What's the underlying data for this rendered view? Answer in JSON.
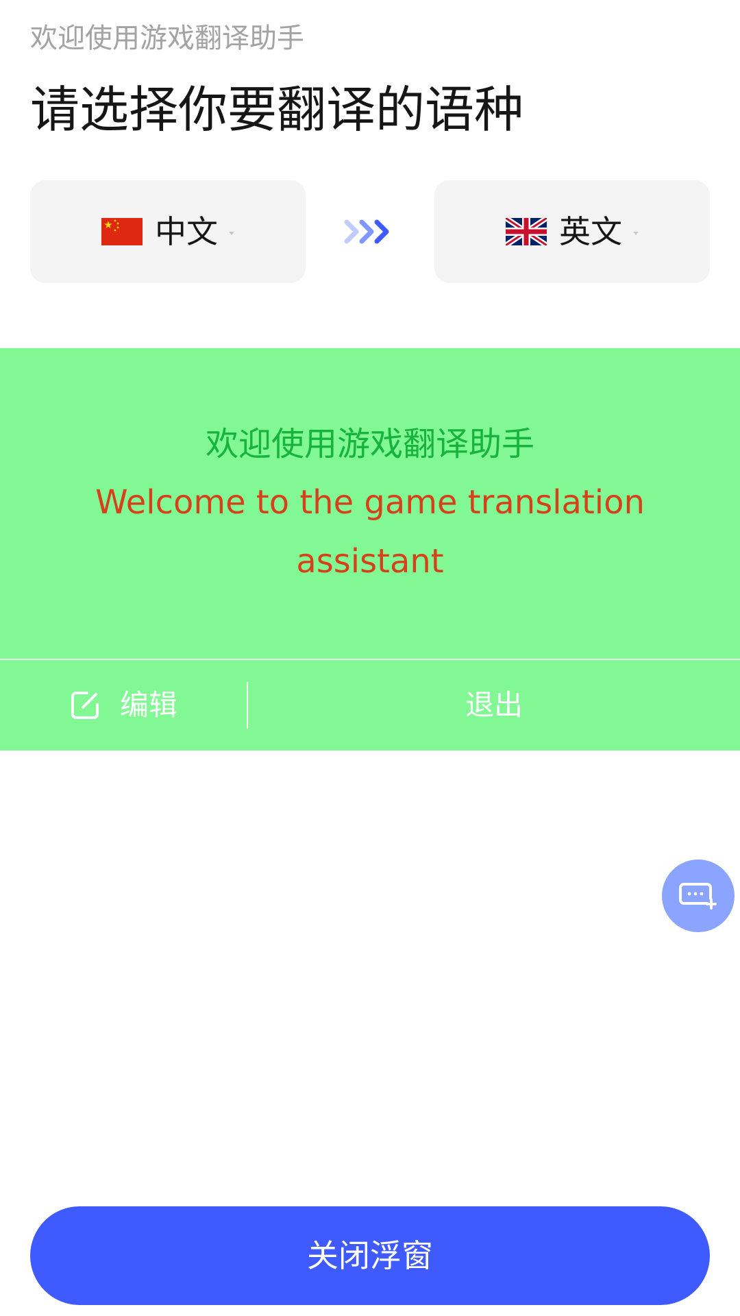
{
  "header": {
    "subtitle": "欢迎使用游戏翻译助手",
    "title": "请选择你要翻译的语种"
  },
  "language_selector": {
    "source": {
      "label": "中文",
      "flag_icon": "china-flag-icon"
    },
    "swap_icon": "triple-chevron-right-icon",
    "target": {
      "label": "英文",
      "flag_icon": "uk-flag-icon"
    }
  },
  "translation_panel": {
    "source_text": "欢迎使用游戏翻译助手",
    "translated_text": "Welcome to the game translation assistant",
    "background_color": "#81f894",
    "source_text_color": "#16b33d",
    "translated_text_color": "#d6401a",
    "edit_label": "编辑",
    "edit_icon": "edit-icon",
    "exit_label": "退出"
  },
  "floating_button": {
    "icon": "message-add-icon",
    "color": "#8aa4ff"
  },
  "footer": {
    "close_button_label": "关闭浮窗",
    "accent_color": "#3f5bff"
  }
}
